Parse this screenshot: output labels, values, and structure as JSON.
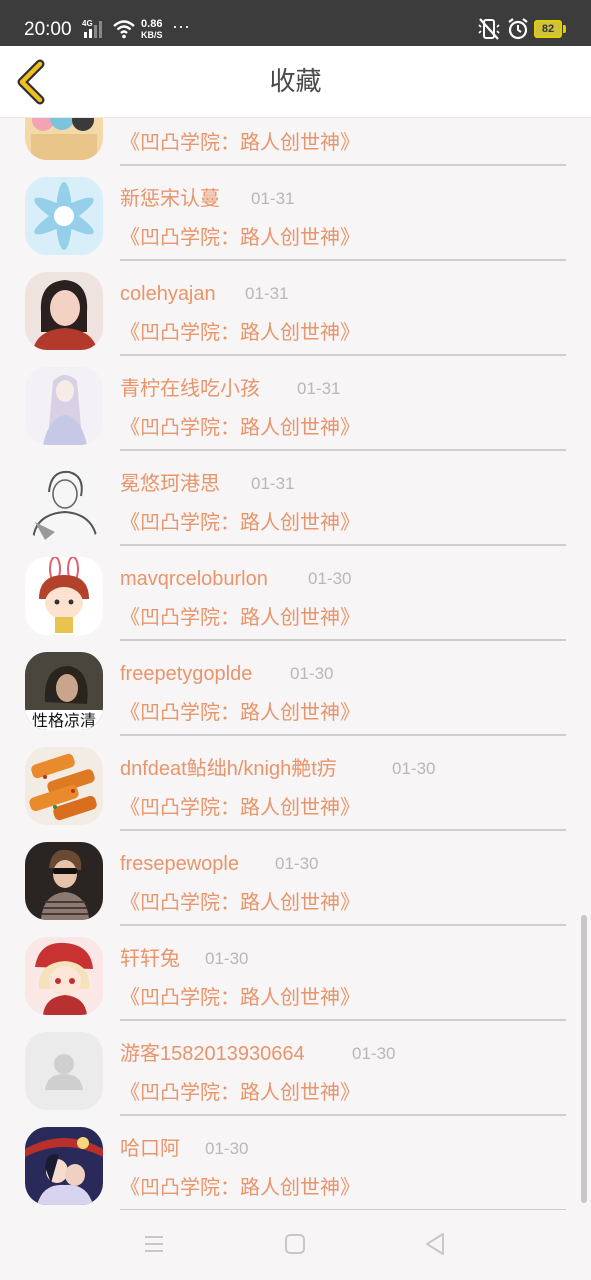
{
  "status_bar": {
    "time": "20:00",
    "network": "4G",
    "speed_value": "0.86",
    "speed_unit": "KB/S",
    "more": "···",
    "battery": "82",
    "icons": [
      "signal-icon",
      "wifi-icon",
      "mute-icon",
      "alarm-icon",
      "battery-icon"
    ]
  },
  "header": {
    "title": "收藏",
    "back_icon": "chevron-left-icon",
    "accent": "#f0c020"
  },
  "list": {
    "text_color": "#e8956b",
    "items": [
      {
        "user": "",
        "date": "",
        "book": "《凹凸学院：路人创世神》"
      },
      {
        "user": "新惩宋认蔓",
        "date": "01-31",
        "book": "《凹凸学院：路人创世神》"
      },
      {
        "user": "colehyajan",
        "date": "01-31",
        "book": "《凹凸学院：路人创世神》"
      },
      {
        "user": "青柠在线吃小孩",
        "date": "01-31",
        "book": "《凹凸学院：路人创世神》"
      },
      {
        "user": "冕悠珂港思",
        "date": "01-31",
        "book": "《凹凸学院：路人创世神》"
      },
      {
        "user": "mavqrceloburlon",
        "date": "01-30",
        "book": "《凹凸学院：路人创世神》"
      },
      {
        "user": "freepetygoplde",
        "date": "01-30",
        "book": "《凹凸学院：路人创世神》"
      },
      {
        "user": "dnfdeat鲇绌h/knigh艴t疠",
        "date": "01-30",
        "book": "《凹凸学院：路人创世神》"
      },
      {
        "user": "fresepewople",
        "date": "01-30",
        "book": "《凹凸学院：路人创世神》"
      },
      {
        "user": "轩轩兔",
        "date": "01-30",
        "book": "《凹凸学院：路人创世神》"
      },
      {
        "user": "游客1582013930664",
        "date": "01-30",
        "book": "《凹凸学院：路人创世神》"
      },
      {
        "user": "哈口阿",
        "date": "01-30",
        "book": "《凹凸学院：路人创世神》"
      }
    ],
    "avatar_7_caption": "性格凉清"
  },
  "nav_bar": {
    "icons": [
      "menu-icon",
      "home-icon",
      "back-icon"
    ]
  }
}
